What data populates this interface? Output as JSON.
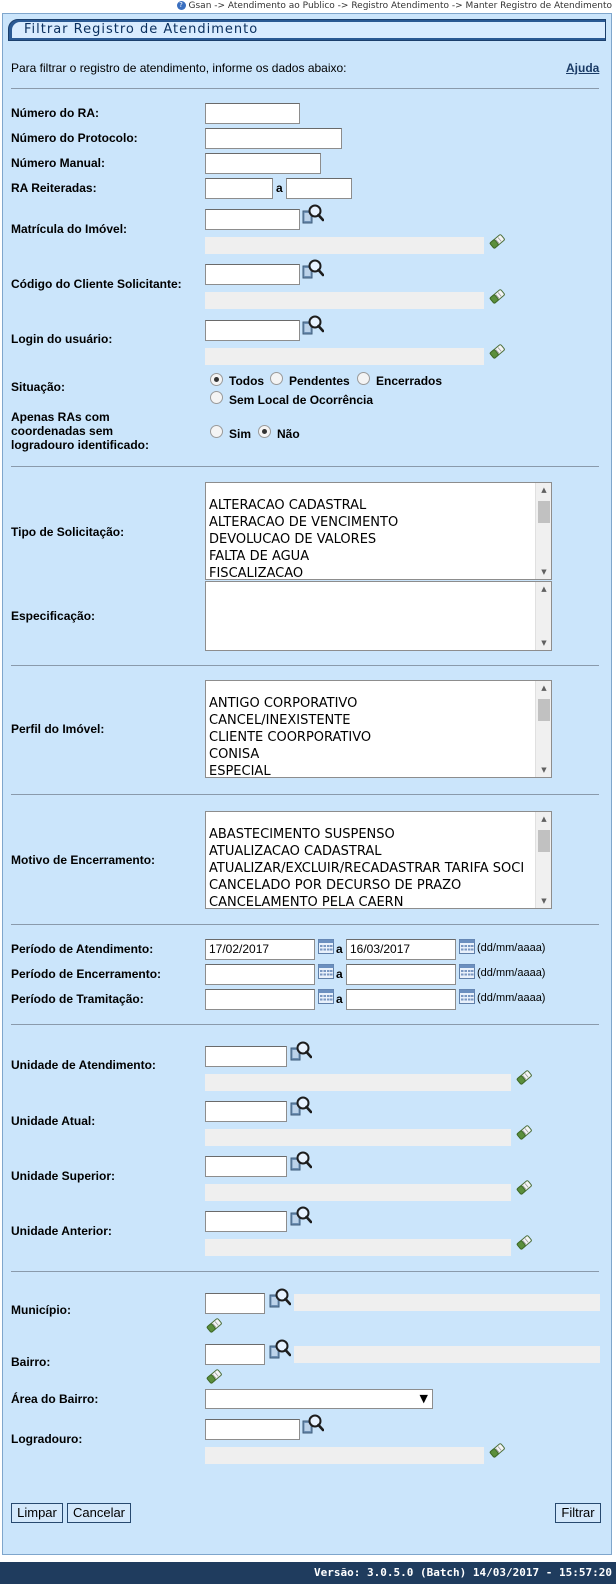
{
  "breadcrumb": "Gsan -> Atendimento ao Publico -> Registro Atendimento -> Manter Registro de Atendimento",
  "title": "Filtrar Registro de Atendimento",
  "intro": "Para filtrar o registro de atendimento, informe os dados abaixo:",
  "help_link": "Ajuda",
  "labels": {
    "numero_ra": "Número do RA:",
    "numero_protocolo": "Número do Protocolo:",
    "numero_manual": "Número Manual:",
    "ra_reiteradas": "RA Reiteradas:",
    "a": "a",
    "matricula_imovel": "Matrícula do Imóvel:",
    "codigo_cliente": "Código do Cliente Solicitante:",
    "login_usuario": "Login do usuário:",
    "situacao": "Situação:",
    "apenas_ras_1": "Apenas RAs com",
    "apenas_ras_2": "coordenadas sem",
    "apenas_ras_3": "logradouro identificado:",
    "tipo_solicitacao": "Tipo de Solicitação:",
    "especificacao": "Especificação:",
    "perfil_imovel": "Perfil do Imóvel:",
    "motivo_encerramento": "Motivo de Encerramento:",
    "periodo_atendimento": "Período de Atendimento:",
    "periodo_encerramento": "Período de Encerramento:",
    "periodo_tramitacao": "Período de Tramitação:",
    "date_format": "(dd/mm/aaaa)",
    "unidade_atendimento": "Unidade de Atendimento:",
    "unidade_atual": "Unidade Atual:",
    "unidade_superior": "Unidade Superior:",
    "unidade_anterior": "Unidade Anterior:",
    "municipio": "Município:",
    "bairro": "Bairro:",
    "area_bairro": "Área do Bairro:",
    "logradouro": "Logradouro:"
  },
  "situacao_options": [
    "Todos",
    "Pendentes",
    "Encerrados",
    "Sem Local de Ocorrência"
  ],
  "situacao_selected": "Todos",
  "coord_options": [
    "Sim",
    "Não"
  ],
  "coord_selected": "Não",
  "tipo_solicitacao_items": [
    "ALTERACAO CADASTRAL",
    "ALTERACAO DE VENCIMENTO",
    "DEVOLUCAO DE VALORES",
    "FALTA DE AGUA",
    "FISCALIZACAO"
  ],
  "perfil_imovel_items": [
    "ANTIGO CORPORATIVO",
    "CANCEL/INEXISTENTE",
    "CLIENTE COORPORATIVO",
    "CONISA",
    "ESPECIAL"
  ],
  "motivo_encerramento_items": [
    "ABASTECIMENTO SUSPENSO",
    "ATUALIZACAO CADASTRAL",
    "ATUALIZAR/EXCLUIR/RECADASTRAR TARIFA SOCI",
    "CANCELADO POR DECURSO DE PRAZO",
    "CANCELAMENTO PELA CAERN"
  ],
  "periodo_atendimento": {
    "inicio": "17/02/2017",
    "fim": "16/03/2017"
  },
  "buttons": {
    "limpar": "Limpar",
    "cancelar": "Cancelar",
    "filtrar": "Filtrar"
  },
  "footer": "Versão: 3.0.5.0 (Batch) 14/03/2017 - 15:57:20",
  "colors": {
    "panel_bg": "#cbe5fb",
    "title_bar": "#2b5a94",
    "footer_bg": "#1f3c5e"
  },
  "icons": {
    "search": "magnifier-icon",
    "clear": "eraser-icon",
    "calendar": "calendar-icon"
  }
}
